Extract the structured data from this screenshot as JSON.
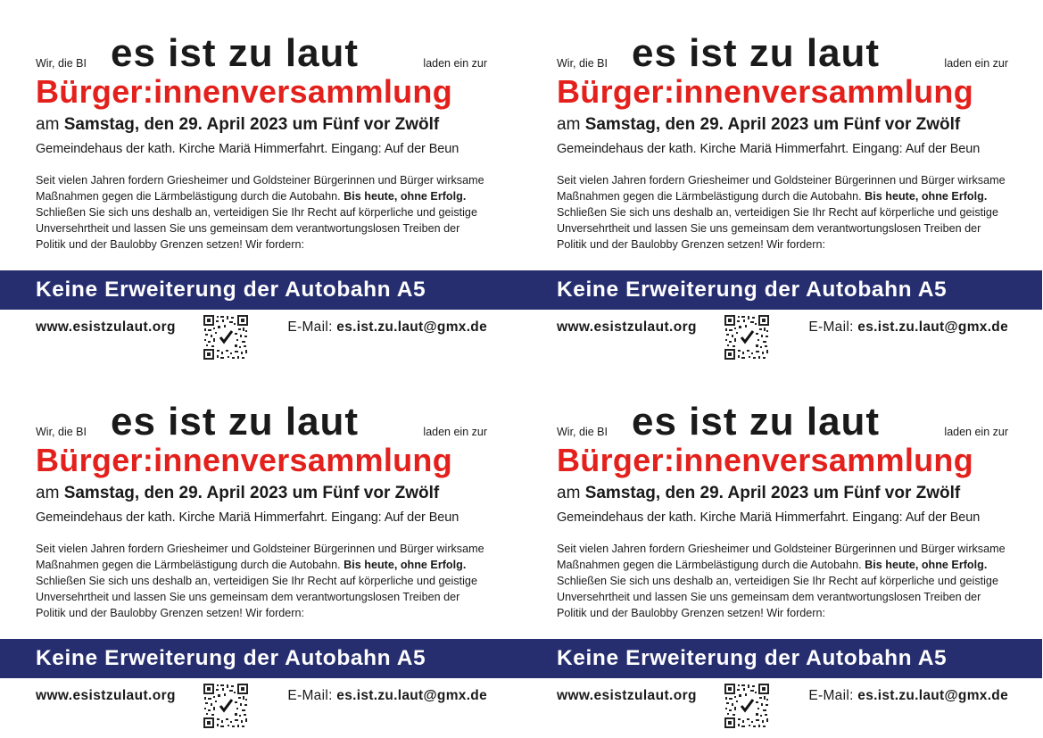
{
  "flyers": [
    {
      "intro_left": "Wir, die BI",
      "title": "es ist zu laut",
      "intro_right": "laden ein zur",
      "event_title": "Bürger:innenversammlung",
      "date_prefix": "am",
      "date_text": "Samstag, den 29. April 2023 um Fünf vor Zwölf",
      "venue": "Gemeindehaus der kath. Kirche Mariä Himmerfahrt. Eingang: Auf der Beun",
      "body_part1": "Seit vielen Jahren fordern Griesheimer und Goldsteiner Bürgerinnen und Bürger wirksame Maßnahmen gegen die Lärmbelästigung durch die Autobahn.",
      "body_bold": "Bis heute, ohne Erfolg.",
      "body_part2": "Schließen Sie sich uns deshalb an, verteidigen Sie Ihr Recht auf körperliche und geistige Unversehrtheit und lassen Sie uns gemeinsam dem verantwortungslosen Treiben der Politik und der Baulobby Grenzen setzen! Wir fordern:",
      "banner": "Keine Erweiterung der Autobahn A5",
      "website": "www.esistzulaut.org",
      "email_label": "E-Mail:",
      "email": "es.ist.zu.laut@gmx.de"
    },
    {
      "intro_left": "Wir, die BI",
      "title": "es ist zu laut",
      "intro_right": "laden ein zur",
      "event_title": "Bürger:innenversammlung",
      "date_prefix": "am",
      "date_text": "Samstag, den 29. April 2023 um Fünf vor Zwölf",
      "venue": "Gemeindehaus der kath. Kirche Mariä Himmerfahrt. Eingang: Auf der Beun",
      "body_part1": "Seit vielen Jahren fordern Griesheimer und Goldsteiner Bürgerinnen und Bürger wirksame Maßnahmen gegen die Lärmbelästigung durch die Autobahn.",
      "body_bold": "Bis heute, ohne Erfolg.",
      "body_part2": "Schließen Sie sich uns deshalb an, verteidigen Sie Ihr Recht auf körperliche und geistige Unversehrtheit und lassen Sie uns gemeinsam dem verantwortungslosen Treiben der Politik und der Baulobby Grenzen setzen! Wir fordern:",
      "banner": "Keine Erweiterung der Autobahn A5",
      "website": "www.esistzulaut.org",
      "email_label": "E-Mail:",
      "email": "es.ist.zu.laut@gmx.de"
    },
    {
      "intro_left": "Wir, die BI",
      "title": "es ist zu laut",
      "intro_right": "laden ein zur",
      "event_title": "Bürger:innenversammlung",
      "date_prefix": "am",
      "date_text": "Samstag, den 29. April 2023 um Fünf vor Zwölf",
      "venue": "Gemeindehaus der kath. Kirche Mariä Himmerfahrt. Eingang: Auf der Beun",
      "body_part1": "Seit vielen Jahren fordern Griesheimer und Goldsteiner Bürgerinnen und Bürger wirksame Maßnahmen gegen die Lärmbelästigung durch die Autobahn.",
      "body_bold": "Bis heute, ohne Erfolg.",
      "body_part2": "Schließen Sie sich uns deshalb an, verteidigen Sie Ihr Recht auf körperliche und geistige Unversehrtheit und lassen Sie uns gemeinsam dem verantwortungslosen Treiben der Politik und der Baulobby Grenzen setzen! Wir fordern:",
      "banner": "Keine Erweiterung der Autobahn A5",
      "website": "www.esistzulaut.org",
      "email_label": "E-Mail:",
      "email": "es.ist.zu.laut@gmx.de"
    },
    {
      "intro_left": "Wir, die BI",
      "title": "es ist zu laut",
      "intro_right": "laden ein zur",
      "event_title": "Bürger:innenversammlung",
      "date_prefix": "am",
      "date_text": "Samstag, den 29. April 2023 um Fünf vor Zwölf",
      "venue": "Gemeindehaus der kath. Kirche Mariä Himmerfahrt. Eingang: Auf der Beun",
      "body_part1": "Seit vielen Jahren fordern Griesheimer und Goldsteiner Bürgerinnen und Bürger wirksame Maßnahmen gegen die Lärmbelästigung durch die Autobahn.",
      "body_bold": "Bis heute, ohne Erfolg.",
      "body_part2": "Schließen Sie sich uns deshalb an, verteidigen Sie Ihr Recht auf körperliche und geistige Unversehrtheit und lassen Sie uns gemeinsam dem verantwortungslosen Treiben der Politik und der Baulobby Grenzen setzen! Wir fordern:",
      "banner": "Keine Erweiterung der Autobahn A5",
      "website": "www.esistzulaut.org",
      "email_label": "E-Mail:",
      "email": "es.ist.zu.laut@gmx.de"
    }
  ],
  "colors": {
    "accent_red": "#e3201b",
    "banner_blue": "#262e70",
    "text": "#1a1a1a"
  },
  "icons": {
    "qr": "qr-code-icon"
  }
}
